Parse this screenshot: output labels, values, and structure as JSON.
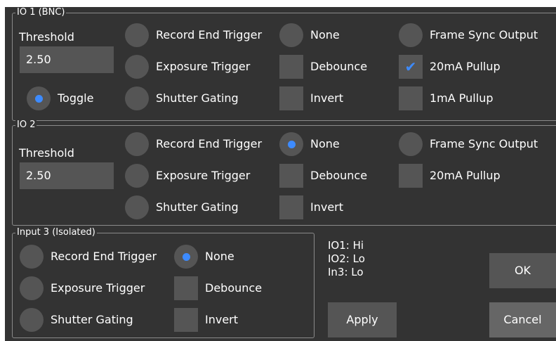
{
  "colors": {
    "background": "#333333",
    "control": "#555555",
    "accent": "#3d8bff",
    "border": "#8a8a8a"
  },
  "io1": {
    "title": "IO 1 (BNC)",
    "threshold_label": "Threshold",
    "threshold_value": "2.50",
    "toggle_label": "Toggle",
    "toggle_selected": true,
    "record_end_trigger": "Record End Trigger",
    "exposure_trigger": "Exposure Trigger",
    "shutter_gating": "Shutter Gating",
    "none": "None",
    "debounce": "Debounce",
    "invert": "Invert",
    "frame_sync_output": "Frame Sync Output",
    "pullup_20ma": "20mA Pullup",
    "pullup_20ma_checked": true,
    "pullup_1ma": "1mA Pullup"
  },
  "io2": {
    "title": "IO 2",
    "threshold_label": "Threshold",
    "threshold_value": "2.50",
    "record_end_trigger": "Record End Trigger",
    "exposure_trigger": "Exposure Trigger",
    "shutter_gating": "Shutter Gating",
    "none": "None",
    "none_selected": true,
    "debounce": "Debounce",
    "invert": "Invert",
    "frame_sync_output": "Frame Sync Output",
    "pullup_20ma": "20mA Pullup"
  },
  "input3": {
    "title": "Input 3 (Isolated)",
    "record_end_trigger": "Record End Trigger",
    "exposure_trigger": "Exposure Trigger",
    "shutter_gating": "Shutter Gating",
    "none": "None",
    "none_selected": true,
    "debounce": "Debounce",
    "invert": "Invert"
  },
  "status": {
    "io1": "IO1: Hi",
    "io2": "IO2: Lo",
    "in3": "In3: Lo"
  },
  "buttons": {
    "ok": "OK",
    "apply": "Apply",
    "cancel": "Cancel"
  }
}
